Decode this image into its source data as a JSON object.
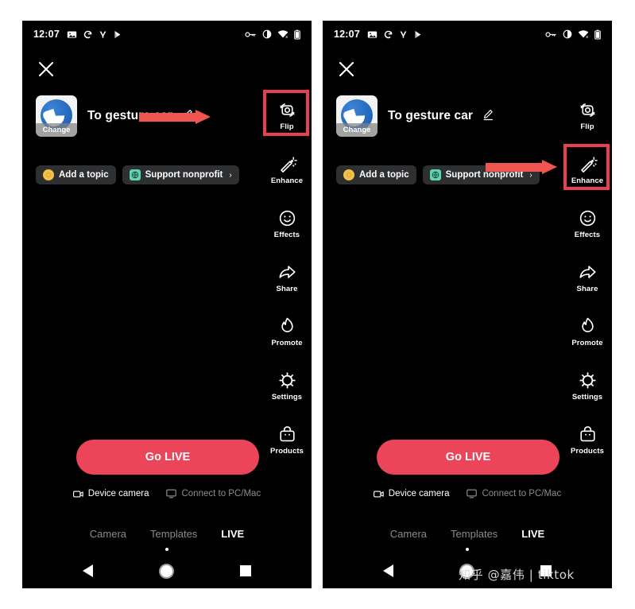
{
  "statusbar": {
    "time": "12:07",
    "left_icons": [
      "image-icon",
      "google-g-icon",
      "y-icon",
      "play-store-icon"
    ],
    "right_icons": [
      "vpn-key-icon",
      "brightness-icon",
      "wifi-off-icon",
      "battery-icon"
    ]
  },
  "header": {
    "close_label": "close-icon",
    "title": "To gesture car",
    "edit_label": "edit-pencil-icon",
    "thumbnail_caption": "Change"
  },
  "chips": [
    {
      "label": "Add a topic",
      "icon": "coin-icon",
      "chevron": ""
    },
    {
      "label": "Support nonprofit",
      "icon": "nonprofit-heart-icon",
      "chevron": "›"
    }
  ],
  "rail": [
    {
      "label": "Flip",
      "icon": "flip-camera-icon"
    },
    {
      "label": "Enhance",
      "icon": "magic-wand-icon"
    },
    {
      "label": "Effects",
      "icon": "smiley-face-icon"
    },
    {
      "label": "Share",
      "icon": "share-arrow-icon"
    },
    {
      "label": "Promote",
      "icon": "flame-icon"
    },
    {
      "label": "Settings",
      "icon": "gear-icon"
    },
    {
      "label": "Products",
      "icon": "shopping-bag-icon"
    }
  ],
  "golive": {
    "label": "Go LIVE",
    "color": "#ec4458"
  },
  "sources": [
    {
      "label": "Device camera",
      "icon": "camera-icon",
      "state": "active"
    },
    {
      "label": "Connect to PC/Mac",
      "icon": "monitor-icon",
      "state": "idle"
    }
  ],
  "modes": [
    {
      "label": "Camera",
      "active": false
    },
    {
      "label": "Templates",
      "active": false
    },
    {
      "label": "LIVE",
      "active": true
    }
  ],
  "navbar": {
    "back": "back-triangle-icon",
    "home": "home-circle-icon",
    "recents": "recents-square-icon"
  },
  "annotation": {
    "highlight_color": "#e8404f",
    "arrow_color": "#f0554f",
    "left_panel_target": "Flip",
    "right_panel_target": "Enhance"
  },
  "watermark": "知乎 @嘉伟 | tiktok"
}
